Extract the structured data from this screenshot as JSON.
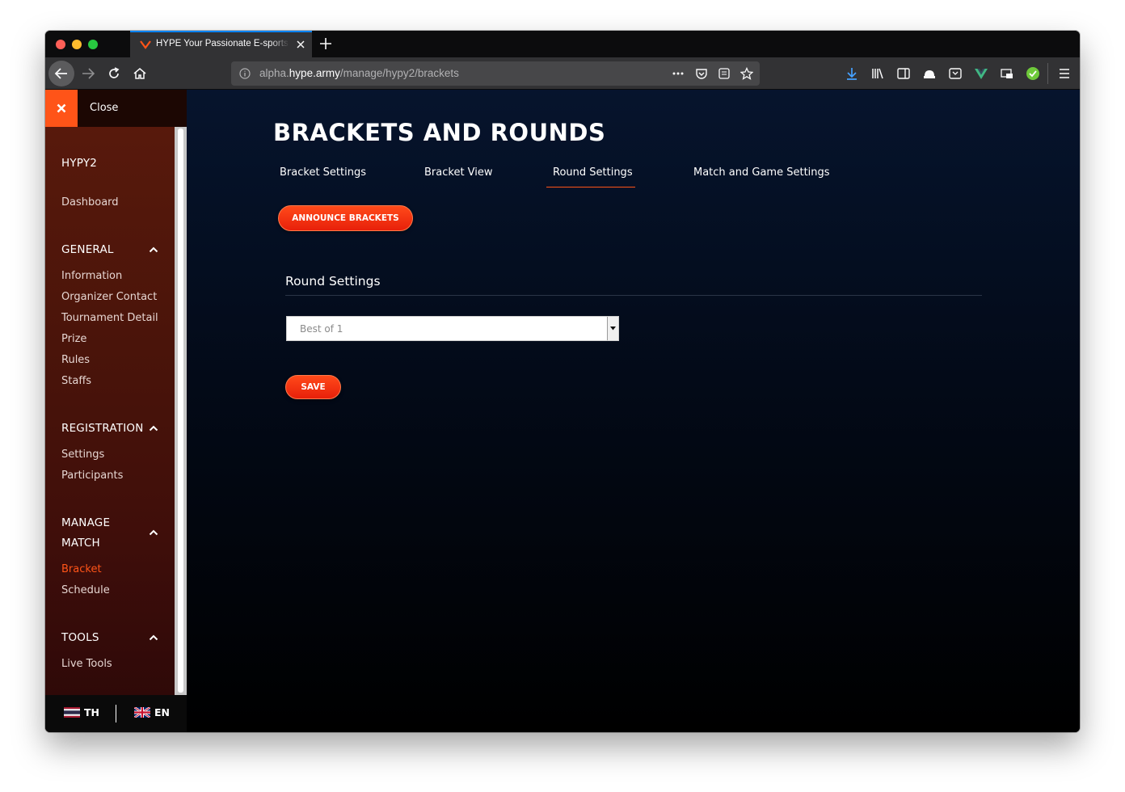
{
  "browser": {
    "tab_title": "HYPE Your Passionate E-sports",
    "url_prefix": "alpha.",
    "url_domain": "hype.army",
    "url_path": "/manage/hypy2/brackets",
    "page_actions_icon": "ellipsis-icon"
  },
  "sidebar": {
    "close_label": "Close",
    "project": "HYPY2",
    "dashboard": "Dashboard",
    "sections": [
      {
        "heading": "GENERAL",
        "items": [
          "Information",
          "Organizer Contact",
          "Tournament Detail",
          "Prize",
          "Rules",
          "Staffs"
        ]
      },
      {
        "heading": "REGISTRATION",
        "items": [
          "Settings",
          "Participants"
        ]
      },
      {
        "heading_line1": "MANAGE",
        "heading_line2": "MATCH",
        "items": [
          "Bracket",
          "Schedule"
        ],
        "active_item": "Bracket"
      },
      {
        "heading": "TOOLS",
        "items": [
          "Live Tools"
        ]
      }
    ],
    "languages": [
      {
        "code": "TH",
        "flag": "thai-flag-icon"
      },
      {
        "code": "EN",
        "flag": "uk-flag-icon"
      }
    ]
  },
  "main": {
    "title": "BRACKETS AND ROUNDS",
    "tabs": [
      {
        "label": "Bracket Settings",
        "active": false
      },
      {
        "label": "Bracket View",
        "active": false
      },
      {
        "label": "Round Settings",
        "active": true
      },
      {
        "label": "Match and Game Settings",
        "active": false
      }
    ],
    "announce_button": "ANNOUNCE BRACKETS",
    "section_title": "Round Settings",
    "select_value": "Best of 1",
    "save_button": "SAVE"
  },
  "colors": {
    "accent": "#ff5418",
    "sidebar_bg": "#4a140a",
    "main_bg": "#06142d"
  }
}
